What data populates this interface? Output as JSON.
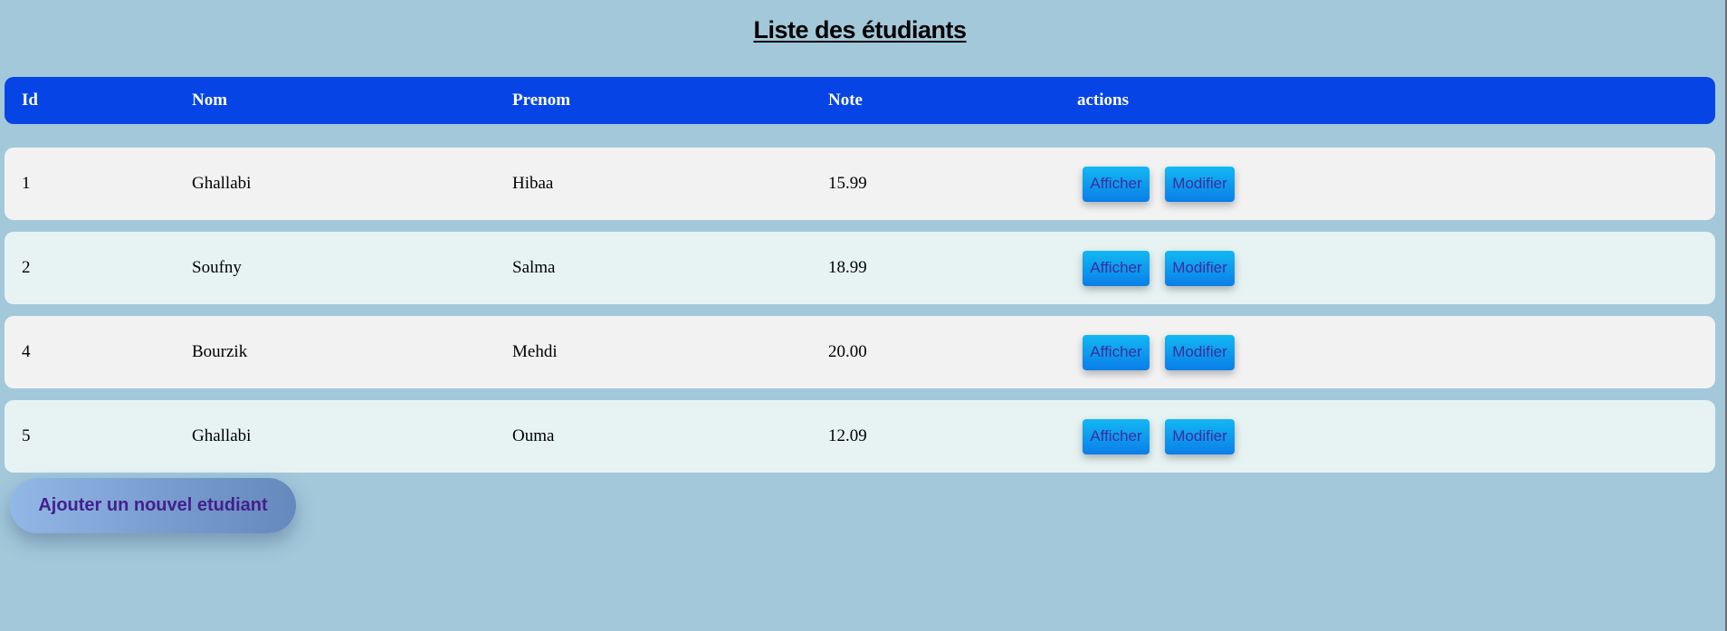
{
  "page": {
    "title": "Liste des étudiants"
  },
  "table": {
    "headers": {
      "id": "Id",
      "nom": "Nom",
      "prenom": "Prenom",
      "note": "Note",
      "actions": "actions"
    },
    "rows": [
      {
        "id": "1",
        "nom": "Ghallabi",
        "prenom": "Hibaa",
        "note": "15.99"
      },
      {
        "id": "2",
        "nom": "Soufny",
        "prenom": "Salma",
        "note": "18.99"
      },
      {
        "id": "4",
        "nom": "Bourzik",
        "prenom": "Mehdi",
        "note": "20.00"
      },
      {
        "id": "5",
        "nom": "Ghallabi",
        "prenom": "Ouma",
        "note": "12.09"
      }
    ],
    "action_labels": {
      "view": "Afficher",
      "edit": "Modifier"
    }
  },
  "footer": {
    "add_button_label": "Ajouter un nouvel etudiant"
  },
  "colors": {
    "background": "#a3c8da",
    "header": "#0644e6",
    "row_odd": "#f3f2f3",
    "row_even": "#e7f3f3",
    "button_blue": "#0a7ee8",
    "button_text": "#3a2ea0",
    "add_button_text": "#44208e"
  }
}
